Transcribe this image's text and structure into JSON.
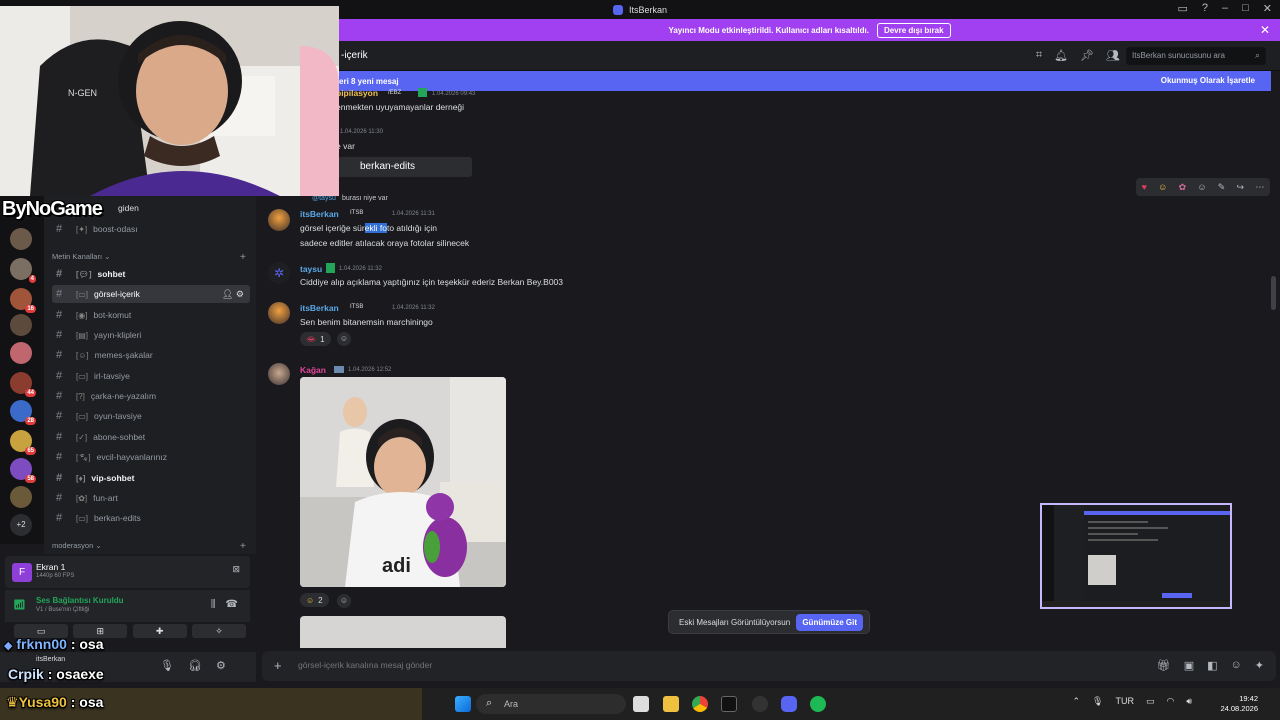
{
  "window": {
    "title": "ItsBerkan"
  },
  "banner": {
    "text": "Yayıncı Modu etkinleştirildi. Kullanıcı adları kısaltıldı.",
    "button": "Devre dışı bırak"
  },
  "header": {
    "channel": "‐içerik",
    "search_placeholder": "ItsBerkan sunucusunu ara"
  },
  "new_messages": {
    "text": "eri 8 yeni mesaj",
    "mark_read": "Okunmuş Olarak İşaretle"
  },
  "server_rail": {
    "badges": [
      "4",
      "16",
      "44",
      "28",
      "65",
      "58"
    ],
    "more": "+2"
  },
  "channels": {
    "partial_top": "giden",
    "boost": "boost-odası",
    "category_text": "Metin Kanalları ⌄",
    "items": [
      {
        "name": "sohbet",
        "state": "unread"
      },
      {
        "name": "görsel-içerik",
        "state": "active"
      },
      {
        "name": "bot-komut",
        "state": "normal"
      },
      {
        "name": "yayın-klipleri",
        "state": "normal"
      },
      {
        "name": "memes-şakalar",
        "state": "normal"
      },
      {
        "name": "irl-tavsiye",
        "state": "normal"
      },
      {
        "name": "çarka-ne-yazalım",
        "state": "normal"
      },
      {
        "name": "oyun-tavsiye",
        "state": "normal"
      },
      {
        "name": "abone-sohbet",
        "state": "normal"
      },
      {
        "name": "evcil-hayvanlarınız",
        "state": "normal"
      },
      {
        "name": "vip-sohbet",
        "state": "unread"
      },
      {
        "name": "fun-art",
        "state": "normal"
      },
      {
        "name": "berkan-edits",
        "state": "normal"
      }
    ],
    "category_mod": "moderasyon ⌄"
  },
  "panels": {
    "screen_title": "Ekran 1",
    "screen_sub": "1440p 60 FPS",
    "voice_title": "Ses Bağlantısı Kuruldu",
    "voice_sub": "V1 / Buse'nin Çiftliği",
    "user": "itsBerkan"
  },
  "messages": {
    "m0_name": "pipilasyon",
    "m0_tag": "/EBZ",
    "m0_time": "1.04.2026 09:43",
    "m0_text": "enmekten uyuyamayanlar derneği",
    "m1_time": "1.04.2026 11:30",
    "m1_text": "e var",
    "m1_embed": "berkan-edits",
    "reply_user": "@taysu",
    "reply_text": "burası niye var",
    "m2_name": "itsBerkan",
    "m2_tag": "ITSB",
    "m2_time": "1.04.2026 11:31",
    "m2_text_a": "görsel içeriğe sür",
    "m2_text_sel": "ekli fo",
    "m2_text_b": "to atıldığı için",
    "m2_text2": "sadece editler atılacak oraya fotolar silinecek",
    "m3_name": "taysu",
    "m3_time": "1.04.2026 11:32",
    "m3_text": "Ciddiye alıp açıklama yaptığınız için teşekkür ederiz Berkan Bey.B003",
    "m4_name": "itsBerkan",
    "m4_tag": "ITSB",
    "m4_time": "1.04.2026 11:32",
    "m4_text": "Sen benim bitanemsin marchiningo",
    "m4_react_count": "1",
    "m5_name": "Kağan",
    "m5_time": "1.04.2026 12:52",
    "m5_react_count": "2"
  },
  "old_messages": {
    "text": "Eski Mesajları Görüntülüyorsun",
    "button": "Günümüze Git"
  },
  "composer": {
    "placeholder": "görsel-içerik kanalına mesaj gönder"
  },
  "overlay": {
    "logo": "ByNoGame",
    "chat1_user": "frknn00",
    "chat1_msg": ": osa",
    "chat2_user": "Crpik",
    "chat2_msg": ": osaexe",
    "chat3_user": "Yusa90",
    "chat3_msg": ": osa"
  },
  "taskbar": {
    "search": "Ara",
    "lang": "TUR",
    "time": "19:42",
    "date": "24.08.2026"
  },
  "colors": {
    "blurple": "#5865f2",
    "banner": "#a040f0",
    "online": "#23a55a",
    "link_name": "#5aa8e6",
    "kagan": "#e0459a"
  }
}
